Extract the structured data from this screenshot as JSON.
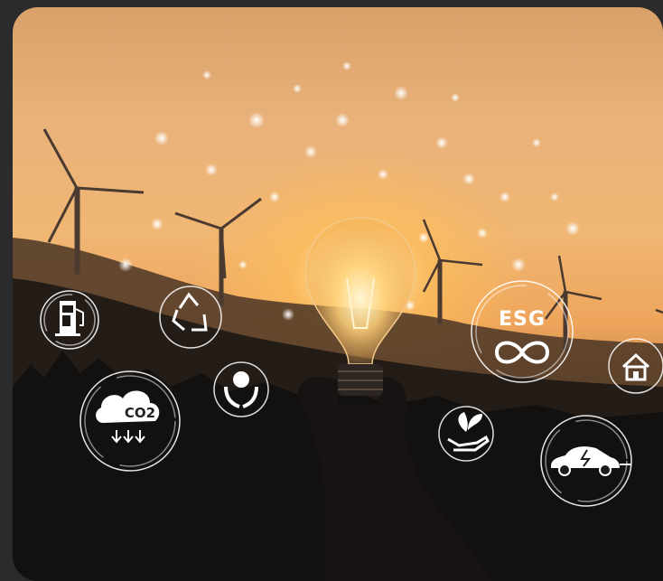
{
  "scene": {
    "icons": {
      "esg": "ESG",
      "co2": "CO2",
      "icon_names": [
        "ev-charger-icon",
        "recycle-icon",
        "co2-cloud-icon",
        "globe-hands-icon",
        "plant-hand-icon",
        "esg-infinity-icon",
        "house-icon",
        "electric-car-icon"
      ]
    },
    "colors": {
      "sky_top": "#d9a06a",
      "sun_glow": "#ffe9a8",
      "hills": "#1a1714",
      "icon_white": "#ffffff"
    }
  }
}
